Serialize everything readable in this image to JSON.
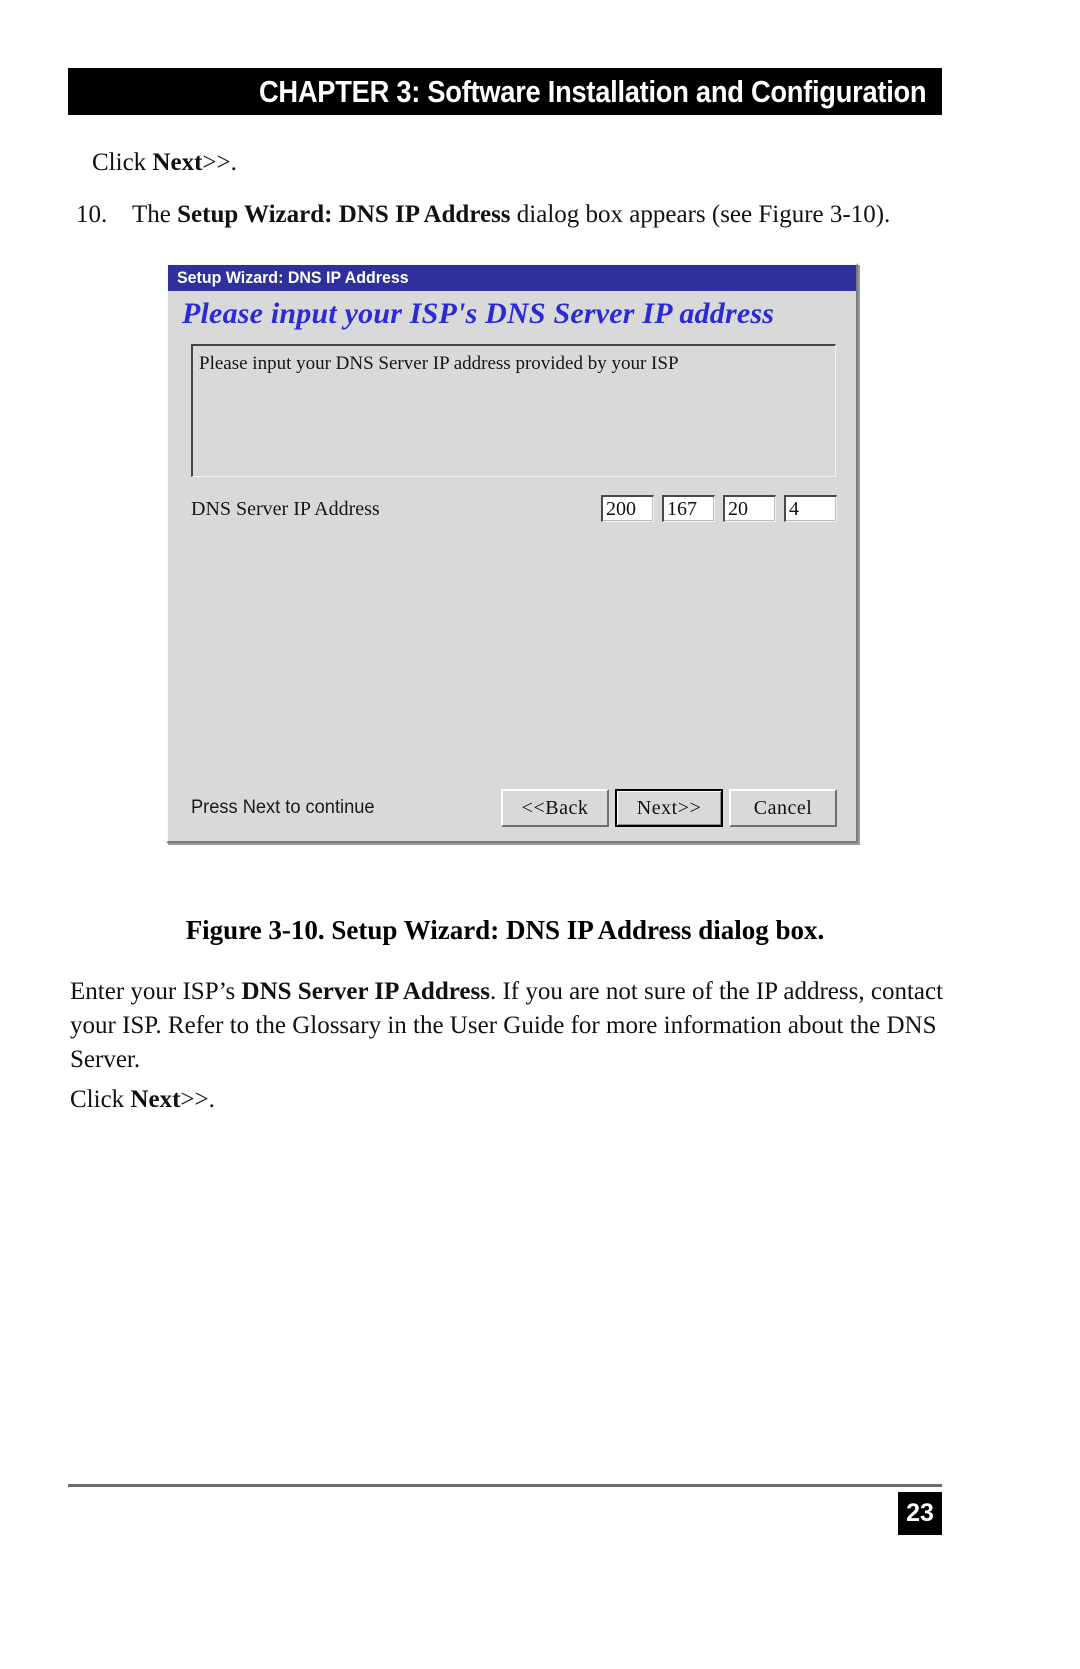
{
  "header": {
    "chapter_title": "CHAPTER 3: Software Installation and Configuration"
  },
  "body": {
    "click_next_1_prefix": "Click ",
    "click_next_1_bold": "Next",
    "click_next_1_suffix": ">>.",
    "item_10_number": "10.",
    "item_10_prefix": "The ",
    "item_10_bold": "Setup Wizard: DNS IP Address",
    "item_10_suffix": " dialog box appears (see Figure 3-10).",
    "caption": "Figure 3-10. Setup Wizard: DNS IP Address dialog box.",
    "enter_prefix": "Enter your ISP’s ",
    "enter_bold": "DNS Server IP Address",
    "enter_suffix": ". If you are not sure of the IP address, contact your ISP. Refer to the Glossary in the User Guide for more information about the DNS Server.",
    "click_next_2_prefix": "Click ",
    "click_next_2_bold": "Next",
    "click_next_2_suffix": ">>."
  },
  "dialog": {
    "title": "Setup Wizard: DNS IP Address",
    "heading": "Please input your ISP's DNS Server IP address",
    "description": "Please input your DNS Server IP address provided by your ISP",
    "ip_label": "DNS Server IP Address",
    "ip_octets": [
      "200",
      "167",
      "20",
      "4"
    ],
    "status": "Press Next to continue",
    "buttons": {
      "back": "<<Back",
      "next": "Next>>",
      "cancel": "Cancel"
    },
    "colors": {
      "titlebar": "#30309c",
      "heading_text": "#2b2bd4",
      "face": "#d9d9d9"
    }
  },
  "footer": {
    "page_number": "23"
  }
}
